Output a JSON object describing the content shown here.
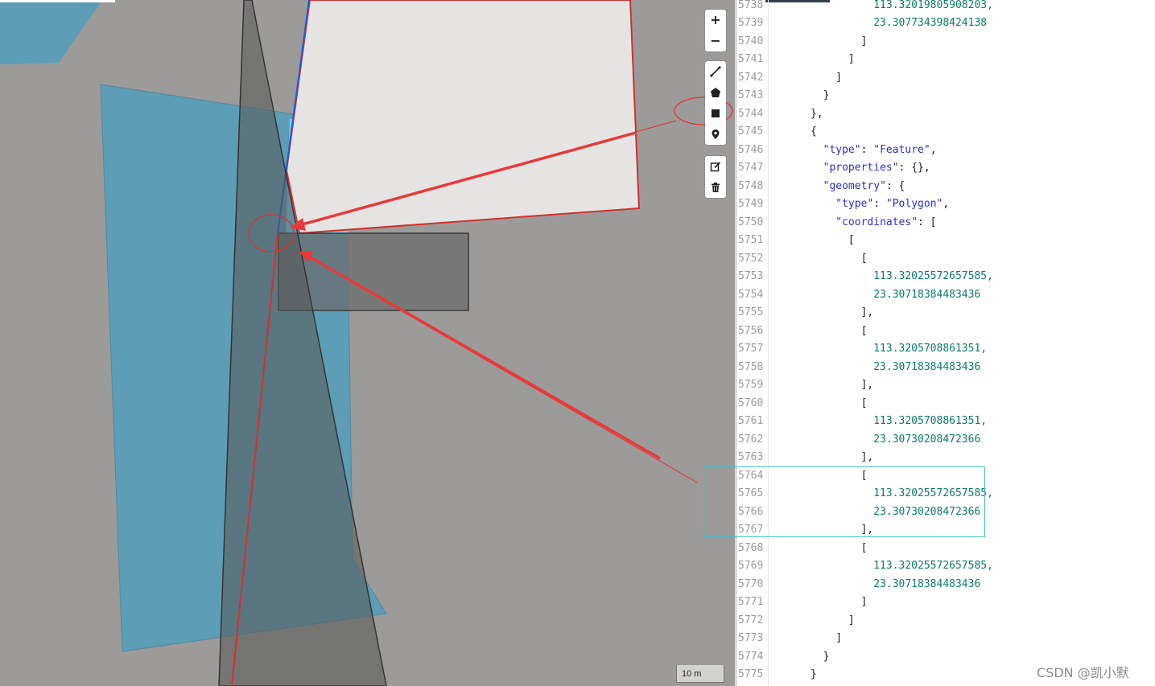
{
  "map": {
    "scale_label": "10 m",
    "controls": {
      "zoom": [
        {
          "label": "+",
          "icon": "zoom-in-icon"
        },
        {
          "label": "−",
          "icon": "zoom-out-icon"
        }
      ],
      "draw": [
        {
          "icon": "draw-line-icon"
        },
        {
          "icon": "draw-polygon-icon"
        },
        {
          "icon": "draw-rectangle-icon"
        },
        {
          "icon": "draw-point-icon"
        }
      ],
      "edit": [
        {
          "icon": "edit-icon"
        },
        {
          "icon": "trash-icon"
        }
      ]
    },
    "colors": {
      "background": "#9c9b9a",
      "polygon_blue": "#5d9db5",
      "polygon_light_blue": "#74cef2",
      "polygon_white": "#e6e4e2",
      "rectangle_fill": "#7b7978",
      "annotation_red": "#e23030",
      "highlight_cyan": "#40c2c8"
    }
  },
  "editor": {
    "lines": [
      {
        "num": "5738",
        "tokens": [
          {
            "t": "                113.32019805908203,",
            "c": "n"
          }
        ]
      },
      {
        "num": "5739",
        "tokens": [
          {
            "t": "                23.307734398424138",
            "c": "n"
          }
        ]
      },
      {
        "num": "5740",
        "tokens": [
          {
            "t": "              ]",
            "c": "p"
          }
        ]
      },
      {
        "num": "5741",
        "tokens": [
          {
            "t": "            ]",
            "c": "p"
          }
        ]
      },
      {
        "num": "5742",
        "tokens": [
          {
            "t": "          ]",
            "c": "p"
          }
        ]
      },
      {
        "num": "5743",
        "tokens": [
          {
            "t": "        }",
            "c": "p"
          }
        ]
      },
      {
        "num": "5744",
        "tokens": [
          {
            "t": "      },",
            "c": "p"
          }
        ]
      },
      {
        "num": "5745",
        "tokens": [
          {
            "t": "      {",
            "c": "p"
          }
        ]
      },
      {
        "num": "5746",
        "tokens": [
          {
            "t": "        ",
            "c": "p"
          },
          {
            "t": "\"type\"",
            "c": "k"
          },
          {
            "t": ": ",
            "c": "p"
          },
          {
            "t": "\"Feature\"",
            "c": "s"
          },
          {
            "t": ",",
            "c": "p"
          }
        ]
      },
      {
        "num": "5747",
        "tokens": [
          {
            "t": "        ",
            "c": "p"
          },
          {
            "t": "\"properties\"",
            "c": "k"
          },
          {
            "t": ": {},",
            "c": "p"
          }
        ]
      },
      {
        "num": "5748",
        "tokens": [
          {
            "t": "        ",
            "c": "p"
          },
          {
            "t": "\"geometry\"",
            "c": "k"
          },
          {
            "t": ": {",
            "c": "p"
          }
        ]
      },
      {
        "num": "5749",
        "tokens": [
          {
            "t": "          ",
            "c": "p"
          },
          {
            "t": "\"type\"",
            "c": "k"
          },
          {
            "t": ": ",
            "c": "p"
          },
          {
            "t": "\"Polygon\"",
            "c": "s"
          },
          {
            "t": ",",
            "c": "p"
          }
        ]
      },
      {
        "num": "5750",
        "tokens": [
          {
            "t": "          ",
            "c": "p"
          },
          {
            "t": "\"coordinates\"",
            "c": "k"
          },
          {
            "t": ": [",
            "c": "p"
          }
        ]
      },
      {
        "num": "5751",
        "tokens": [
          {
            "t": "            [",
            "c": "p"
          }
        ]
      },
      {
        "num": "5752",
        "tokens": [
          {
            "t": "              [",
            "c": "p"
          }
        ]
      },
      {
        "num": "5753",
        "tokens": [
          {
            "t": "                113.32025572657585,",
            "c": "n"
          }
        ]
      },
      {
        "num": "5754",
        "tokens": [
          {
            "t": "                23.30718384483436",
            "c": "n"
          }
        ]
      },
      {
        "num": "5755",
        "tokens": [
          {
            "t": "              ],",
            "c": "p"
          }
        ]
      },
      {
        "num": "5756",
        "tokens": [
          {
            "t": "              [",
            "c": "p"
          }
        ]
      },
      {
        "num": "5757",
        "tokens": [
          {
            "t": "                113.3205708861351,",
            "c": "n"
          }
        ]
      },
      {
        "num": "5758",
        "tokens": [
          {
            "t": "                23.30718384483436",
            "c": "n"
          }
        ]
      },
      {
        "num": "5759",
        "tokens": [
          {
            "t": "              ],",
            "c": "p"
          }
        ]
      },
      {
        "num": "5760",
        "tokens": [
          {
            "t": "              [",
            "c": "p"
          }
        ]
      },
      {
        "num": "5761",
        "tokens": [
          {
            "t": "                113.3205708861351,",
            "c": "n"
          }
        ]
      },
      {
        "num": "5762",
        "tokens": [
          {
            "t": "                23.30730208472366",
            "c": "n"
          }
        ]
      },
      {
        "num": "5763",
        "tokens": [
          {
            "t": "              ],",
            "c": "p"
          }
        ]
      },
      {
        "num": "5764",
        "tokens": [
          {
            "t": "              [",
            "c": "p"
          }
        ]
      },
      {
        "num": "5765",
        "tokens": [
          {
            "t": "                113.32025572657585,",
            "c": "n"
          }
        ]
      },
      {
        "num": "5766",
        "tokens": [
          {
            "t": "                23.30730208472366",
            "c": "n"
          }
        ]
      },
      {
        "num": "5767",
        "tokens": [
          {
            "t": "              ],",
            "c": "p"
          }
        ]
      },
      {
        "num": "5768",
        "tokens": [
          {
            "t": "              [",
            "c": "p"
          }
        ]
      },
      {
        "num": "5769",
        "tokens": [
          {
            "t": "                113.32025572657585,",
            "c": "n"
          }
        ]
      },
      {
        "num": "5770",
        "tokens": [
          {
            "t": "                23.30718384483436",
            "c": "n"
          }
        ]
      },
      {
        "num": "5771",
        "tokens": [
          {
            "t": "              ]",
            "c": "p"
          }
        ]
      },
      {
        "num": "5772",
        "tokens": [
          {
            "t": "            ]",
            "c": "p"
          }
        ]
      },
      {
        "num": "5773",
        "tokens": [
          {
            "t": "          ]",
            "c": "p"
          }
        ]
      },
      {
        "num": "5774",
        "tokens": [
          {
            "t": "        }",
            "c": "p"
          }
        ]
      },
      {
        "num": "5775",
        "tokens": [
          {
            "t": "      }",
            "c": "p"
          }
        ]
      }
    ]
  },
  "watermark": "CSDN @凯小默"
}
